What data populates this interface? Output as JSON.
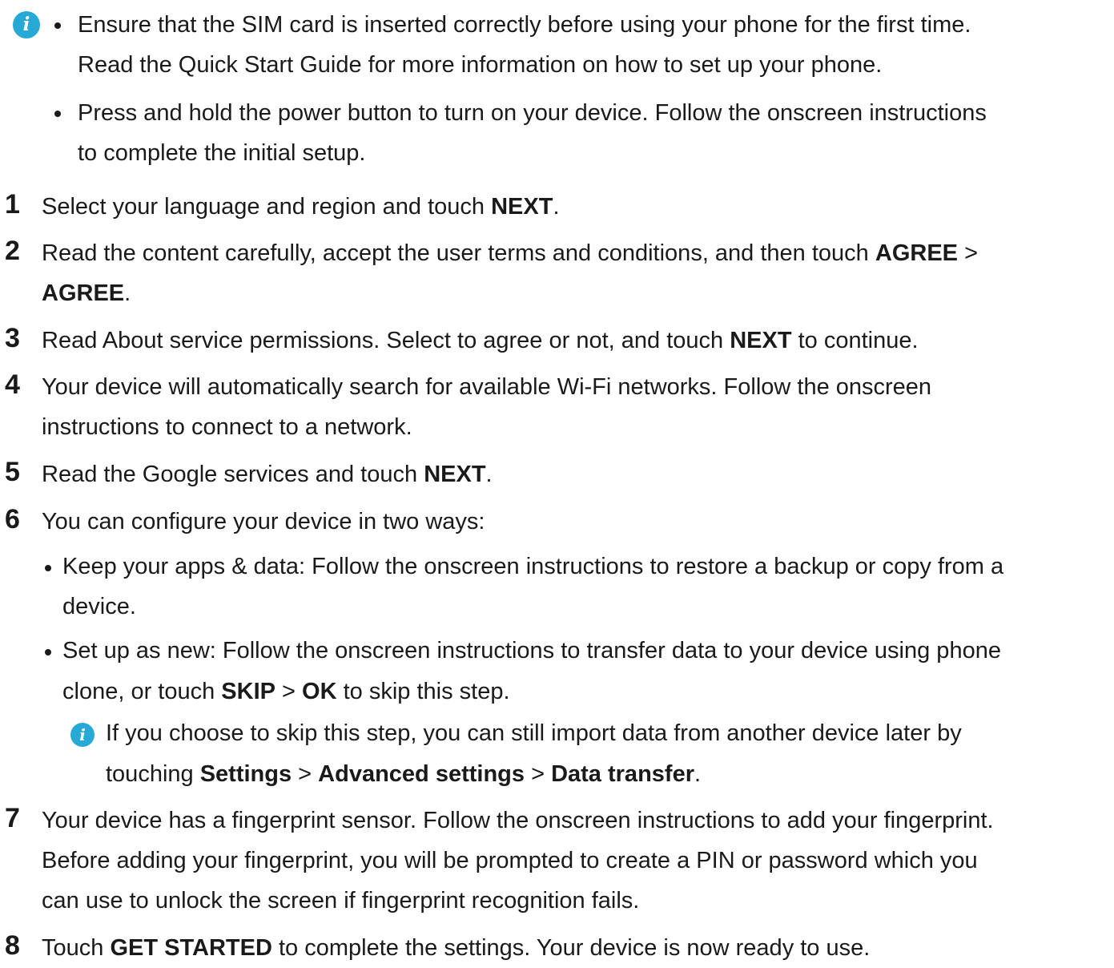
{
  "note_top": {
    "bullets": [
      {
        "line1": "Ensure that the SIM card is inserted correctly before using your phone for the first time.",
        "line2": "Read the Quick Start Guide for more information on how to set up your phone."
      },
      {
        "line1": "Press and hold the power button to turn on your device. Follow the onscreen instructions",
        "line2": "to complete the initial setup."
      }
    ]
  },
  "steps": [
    {
      "num": "1",
      "t1": "Select your language and region and touch ",
      "b1": "NEXT",
      "t2": "."
    },
    {
      "num": "2",
      "t1": "Read the content carefully, accept the user terms and conditions, and then touch ",
      "b1": "AGREE",
      "t2": " >",
      "b2": "AGREE",
      "t3": "."
    },
    {
      "num": "3",
      "t1": "Read About service permissions. Select to agree or not, and touch ",
      "b1": "NEXT",
      "t2": " to continue."
    },
    {
      "num": "4",
      "line1": "Your device will automatically search for available Wi-Fi networks. Follow the onscreen",
      "line2": "instructions to connect to a network."
    },
    {
      "num": "5",
      "t1": "Read the Google services and touch ",
      "b1": "NEXT",
      "t2": "."
    },
    {
      "num": "6",
      "line1": "You can configure your device in two ways:",
      "sub1": {
        "line1": "Keep your apps & data: Follow the onscreen instructions to restore a backup or copy from a",
        "line2": "device."
      },
      "sub2": {
        "line1": "Set up as new: Follow the onscreen instructions to transfer data to your device using phone",
        "t1": "clone, or touch ",
        "b1": "SKIP",
        "t2": " > ",
        "b2": "OK",
        "t3": " to skip this step."
      },
      "note": {
        "line1": "If you choose to skip this step, you can still import data from another device later by",
        "t1": "touching ",
        "b1": "Settings",
        "t2": " > ",
        "b2": "Advanced settings",
        "t3": " > ",
        "b3": "Data transfer",
        "t4": "."
      }
    },
    {
      "num": "7",
      "line1": "Your device has a fingerprint sensor. Follow the onscreen instructions to add your fingerprint.",
      "line2": "Before adding your fingerprint, you will be prompted to create a PIN or password which you",
      "line3": "can use to unlock the screen if fingerprint recognition fails."
    },
    {
      "num": "8",
      "t1": "Touch ",
      "b1": "GET STARTED",
      "t2": " to complete the settings. Your device is now ready to use."
    }
  ],
  "colors": {
    "info_icon": "#27a9d6",
    "text": "#1a1a1a"
  },
  "icons": [
    "info-icon"
  ]
}
